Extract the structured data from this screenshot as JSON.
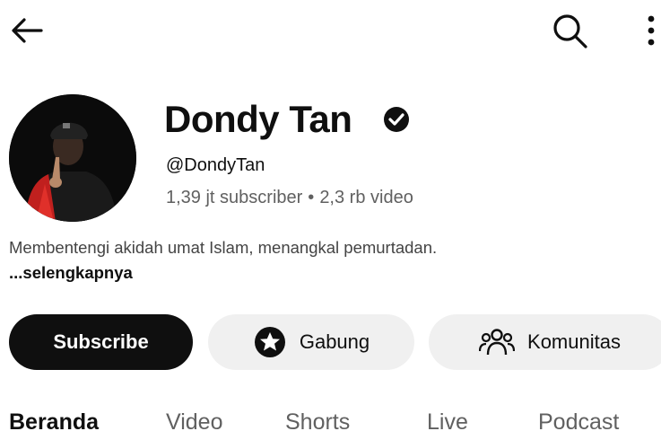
{
  "header": {
    "back_icon": "arrow-left-icon",
    "search_icon": "search-icon",
    "more_icon": "more-vertical-icon"
  },
  "channel": {
    "name": "Dondy Tan",
    "verified_icon": "verified-check-icon",
    "handle": "@DondyTan",
    "subscribers": "1,39 jt subscriber",
    "separator": "•",
    "videos": "2,3 rb video",
    "description": "Membentengi akidah umat Islam, menangkal pemurtadan. ",
    "more_label": "...selengkapnya"
  },
  "actions": {
    "subscribe_label": "Subscribe",
    "join_label": "Gabung",
    "join_icon": "star-badge-icon",
    "community_label": "Komunitas",
    "community_icon": "people-icon"
  },
  "tabs": [
    {
      "label": "Beranda",
      "active": true
    },
    {
      "label": "Video",
      "active": false
    },
    {
      "label": "Shorts",
      "active": false
    },
    {
      "label": "Live",
      "active": false
    },
    {
      "label": "Podcast",
      "active": false
    }
  ],
  "colors": {
    "text": "#0f0f0f",
    "secondary_text": "#606060",
    "button_dark": "#0f0f0f",
    "button_light": "#f0f0f0"
  }
}
